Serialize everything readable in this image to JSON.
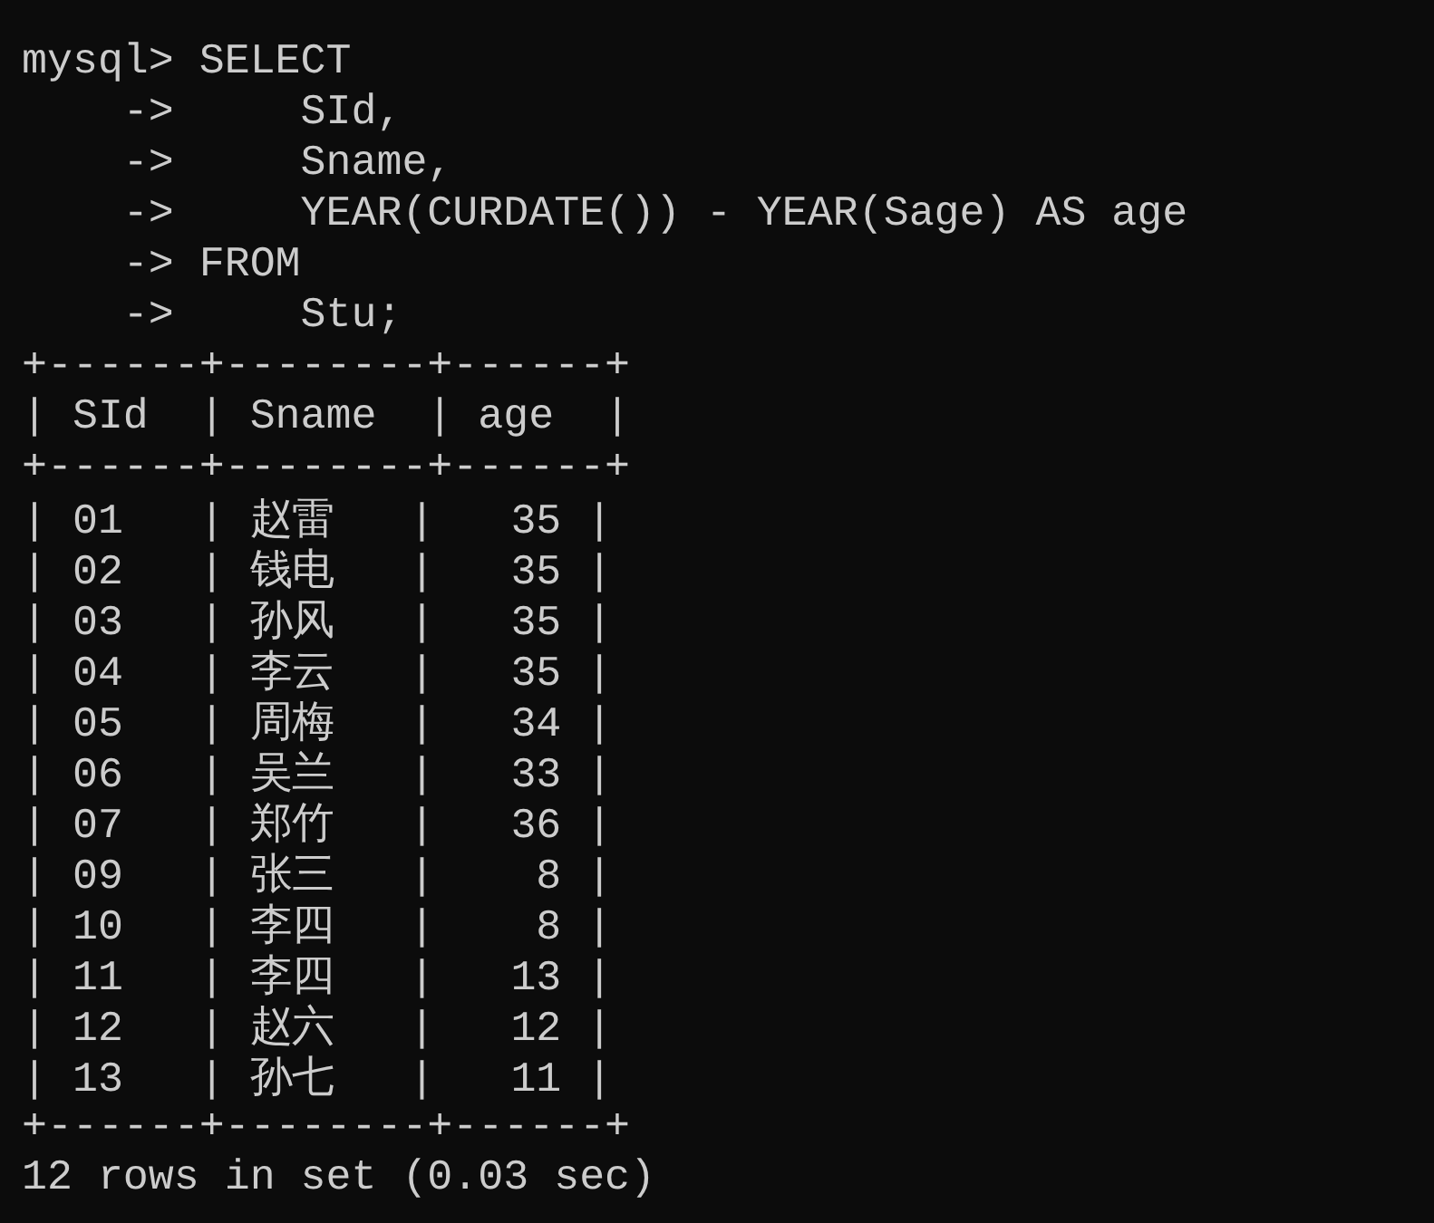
{
  "terminal": {
    "lines": [
      "mysql> SELECT",
      "    ->     SId,",
      "    ->     Sname,",
      "    ->     YEAR(CURDATE()) - YEAR(Sage) AS age",
      "    -> FROM",
      "    ->     Stu;",
      "+------+--------+------+",
      "| SId  | Sname  | age  |",
      "+------+--------+------+",
      "| 01   | 赵雷   |   35 |",
      "| 02   | 钱电   |   35 |",
      "| 03   | 孙风   |   35 |",
      "| 04   | 李云   |   35 |",
      "| 05   | 周梅   |   34 |",
      "| 06   | 吴兰   |   33 |",
      "| 07   | 郑竹   |   36 |",
      "| 09   | 张三   |    8 |",
      "| 10   | 李四   |    8 |",
      "| 11   | 李四   |   13 |",
      "| 12   | 赵六   |   12 |",
      "| 13   | 孙七   |   11 |",
      "+------+--------+------+",
      "12 rows in set (0.03 sec)"
    ]
  }
}
